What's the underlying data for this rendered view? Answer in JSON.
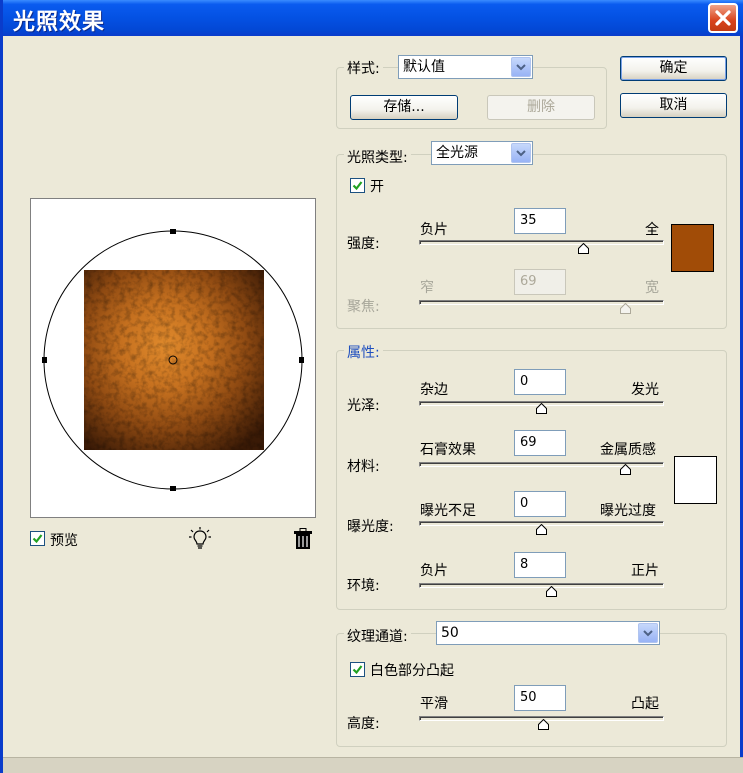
{
  "window": {
    "title": "光照效果"
  },
  "buttons": {
    "ok": "确定",
    "cancel": "取消",
    "save": "存储...",
    "delete": "删除"
  },
  "style": {
    "label": "样式:",
    "value": "默认值"
  },
  "light_type": {
    "label": "光照类型:",
    "value": "全光源",
    "on_label": "开",
    "on_checked": true
  },
  "intensity": {
    "label": "强度:",
    "min_label": "负片",
    "max_label": "全",
    "value": "35"
  },
  "focus": {
    "label": "聚焦:",
    "min_label": "窄",
    "max_label": "宽",
    "value": "69"
  },
  "light_color": "#a14c07",
  "properties": {
    "header": "属性:",
    "gloss": {
      "label": "光泽:",
      "min_label": "杂边",
      "max_label": "发光",
      "value": "0"
    },
    "material": {
      "label": "材料:",
      "min_label": "石膏效果",
      "max_label": "金属质感",
      "value": "69"
    },
    "exposure": {
      "label": "曝光度:",
      "min_label": "曝光不足",
      "max_label": "曝光过度",
      "value": "0"
    },
    "ambience": {
      "label": "环境:",
      "min_label": "负片",
      "max_label": "正片",
      "value": "8"
    },
    "ambient_color": "#ffffff"
  },
  "texture": {
    "label": "纹理通道:",
    "value": "50",
    "white_high_label": "白色部分凸起",
    "white_high_checked": true,
    "height_label": "高度:",
    "min_label": "平滑",
    "max_label": "凸起"
  },
  "preview": {
    "label": "预览",
    "checked": true
  }
}
